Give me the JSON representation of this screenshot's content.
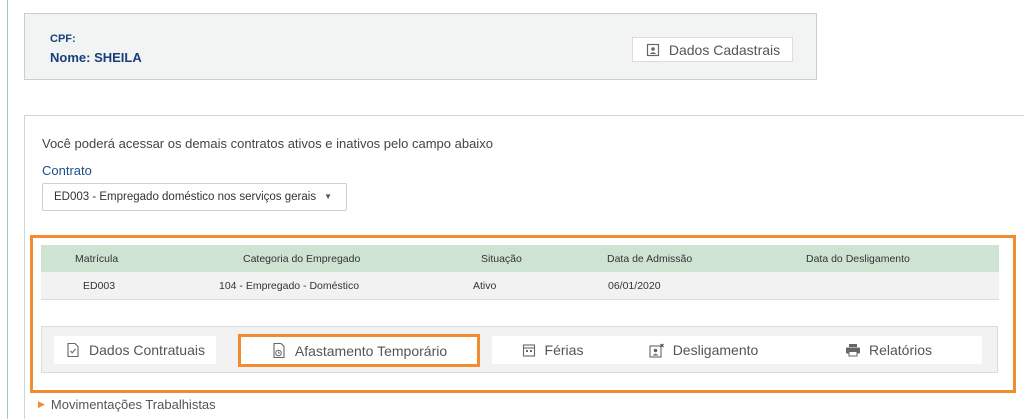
{
  "header": {
    "cpf_label": "CPF:",
    "nome_label": "Nome:",
    "nome_value": "SHEILA",
    "dados_cadastrais_label": "Dados Cadastrais"
  },
  "contract": {
    "hint": "Você poderá acessar os demais contratos ativos e inativos pelo campo abaixo",
    "label": "Contrato",
    "selected": "ED003 - Empregado doméstico nos serviços gerais"
  },
  "table": {
    "headers": [
      "Matrícula",
      "Categoria do Empregado",
      "Situação",
      "Data de Admissão",
      "Data do Desligamento"
    ],
    "rows": [
      [
        "ED003",
        "104 - Empregado - Doméstico",
        "Ativo",
        "06/01/2020",
        ""
      ]
    ]
  },
  "tabs": [
    {
      "label": "Dados Contratuais",
      "icon": "document-icon"
    },
    {
      "label": "Afastamento Temporário",
      "icon": "document-clock-icon"
    },
    {
      "label": "Férias",
      "icon": "calendar-icon"
    },
    {
      "label": "Desligamento",
      "icon": "person-remove-icon"
    },
    {
      "label": "Relatórios",
      "icon": "printer-icon"
    }
  ],
  "active_tab": "Afastamento Temporário",
  "section": {
    "movimentacoes": "Movimentações Trabalhistas"
  },
  "colors": {
    "highlight": "#f28b30",
    "name_blue": "#16407a",
    "table_header_bg": "#cfe3d3"
  }
}
